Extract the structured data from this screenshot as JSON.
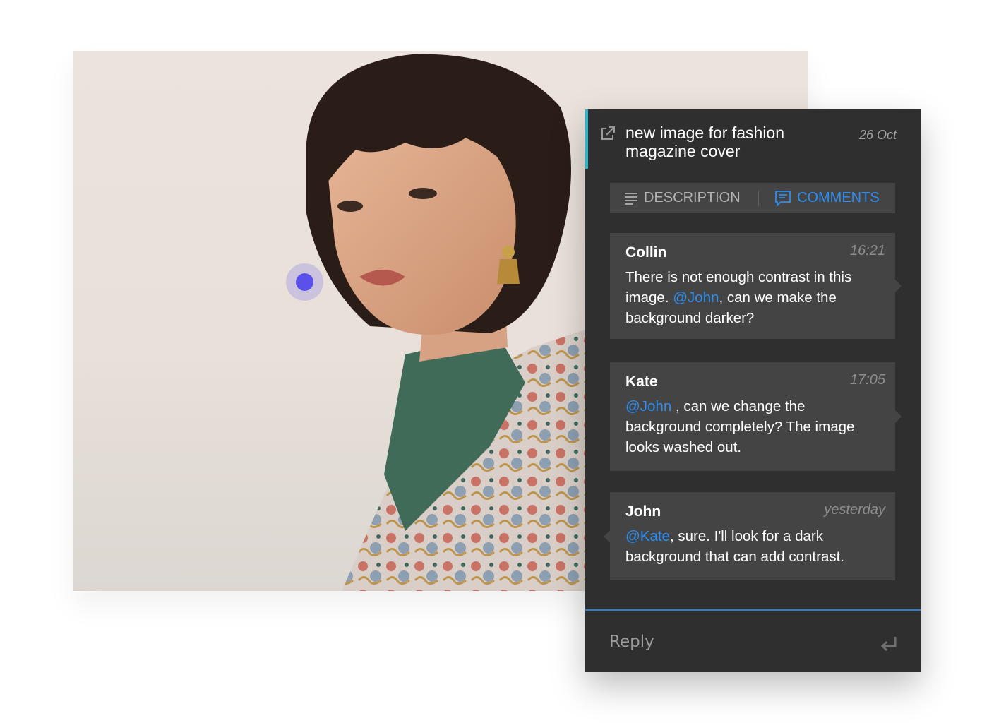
{
  "panel": {
    "title": "new image for fashion magazine cover",
    "date": "26 Oct",
    "tabs": [
      {
        "label": "DESCRIPTION",
        "icon": "lines-icon",
        "active": false
      },
      {
        "label": "COMMENTS",
        "icon": "comment-icon",
        "active": true
      }
    ],
    "comments": [
      {
        "author": "Collin",
        "time": "16:21",
        "text_before": "There is not enough contrast in this image. ",
        "mention": "@John",
        "text_after": ", can we make the background darker?"
      },
      {
        "author": "Kate",
        "time": "17:05",
        "mention": "@John",
        "text_after": " , can we change the background completely? The image looks washed out."
      },
      {
        "author": "John",
        "time": "yesterday",
        "mention": "@Kate",
        "text_after": ", sure. I'll look for a dark background that can add contrast."
      }
    ],
    "reply": {
      "placeholder": "Reply",
      "icon": "enter-icon"
    }
  },
  "colors": {
    "accent": "#1fb8cc",
    "mention": "#2e8df0",
    "pin": "#5b50ea",
    "panel_bg": "#2f2f2f"
  }
}
